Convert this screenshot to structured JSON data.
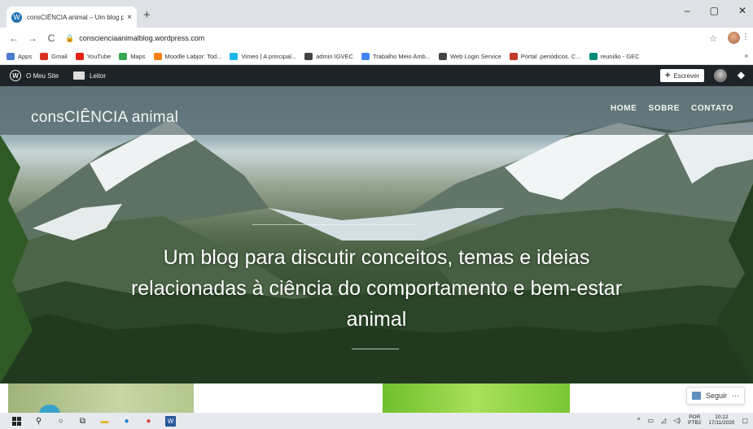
{
  "browser": {
    "tab_title": "consCIÊNCIA animal – Um blog p",
    "tab_close": "×",
    "new_tab": "+",
    "window_controls": {
      "minimize": "–",
      "maximize": "▢",
      "close": "✕"
    },
    "nav": {
      "back": "←",
      "forward": "→",
      "reload": "C"
    },
    "url": "conscienciaanimalblog.wordpress.com",
    "bookmarks": [
      {
        "label": "Apps",
        "icon": "apps-grid-icon",
        "color": "#4a7bd0"
      },
      {
        "label": "Gmail",
        "icon": "gmail-icon",
        "color": "#d93025"
      },
      {
        "label": "YouTube",
        "icon": "youtube-icon",
        "color": "#e62117"
      },
      {
        "label": "Maps",
        "icon": "maps-icon",
        "color": "#34a853"
      },
      {
        "label": "Moodle Labjor: Tod...",
        "icon": "moodle-icon",
        "color": "#f98012"
      },
      {
        "label": "Vimeo | A principal...",
        "icon": "vimeo-icon",
        "color": "#1ab7ea"
      },
      {
        "label": "admin IGVEC",
        "icon": "globe-icon",
        "color": "#444444"
      },
      {
        "label": "Trabalho Meio Amb...",
        "icon": "docs-icon",
        "color": "#4285f4"
      },
      {
        "label": "Web Login Service",
        "icon": "globe-icon",
        "color": "#444444"
      },
      {
        "label": "Portal .periódicos. C...",
        "icon": "portal-icon",
        "color": "#c0392b"
      },
      {
        "label": "reunião - GEC",
        "icon": "meet-icon",
        "color": "#00897b"
      }
    ],
    "bookmarks_more": "»"
  },
  "wp_admin_bar": {
    "my_site": "O Meu Site",
    "reader": "Leitor",
    "write_button": "Escrever"
  },
  "site": {
    "title": "consCIÊNCIA animal",
    "nav": [
      "HOME",
      "SOBRE",
      "CONTATO"
    ],
    "tagline": "Um blog para discutir conceitos, temas e ideias relacionadas à ciência do comportamento e bem-estar animal",
    "follow_button": "Seguir",
    "follow_more": "···"
  },
  "taskbar": {
    "language": "POR",
    "language_sub": "PTB2",
    "time": "10:12",
    "date": "17/11/2020"
  }
}
